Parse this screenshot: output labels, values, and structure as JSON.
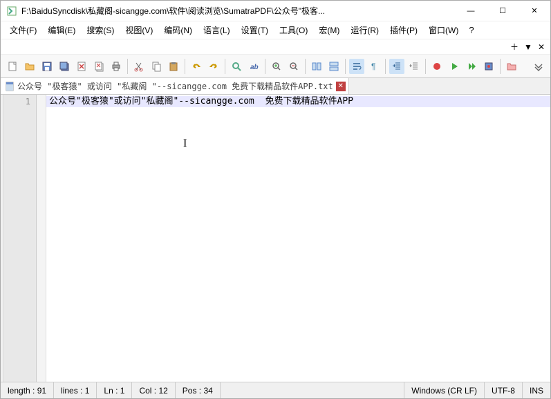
{
  "title": "F:\\BaiduSyncdisk\\私藏阁-sicangge.com\\软件\\阅读浏览\\SumatraPDF\\公众号\"极客...",
  "menus": {
    "file": "文件(F)",
    "edit": "编辑(E)",
    "search": "搜索(S)",
    "view": "视图(V)",
    "encoding": "编码(N)",
    "language": "语言(L)",
    "settings": "设置(T)",
    "tools": "工具(O)",
    "macro": "宏(M)",
    "run": "运行(R)",
    "plugins": "插件(P)",
    "window": "窗口(W)",
    "help": "?"
  },
  "extra": {
    "plus": "＋",
    "down": "▼",
    "close": "✕"
  },
  "tab": {
    "label": "公众号 \"极客猿\" 或访问 \"私藏阁 \"--sicangge.com  免费下载精品软件APP.txt",
    "close": "✕"
  },
  "editor": {
    "line_no": "1",
    "line1": "公众号\"极客猿\"或访问\"私藏阁\"--sicangge.com  免费下载精品软件APP"
  },
  "status": {
    "length": "length : 91",
    "lines": "lines : 1",
    "ln": "Ln : 1",
    "col": "Col : 12",
    "pos": "Pos : 34",
    "eol": "Windows (CR LF)",
    "enc": "UTF-8",
    "ins": "INS"
  },
  "winbtn": {
    "min": "—",
    "max": "☐",
    "close": "✕"
  }
}
